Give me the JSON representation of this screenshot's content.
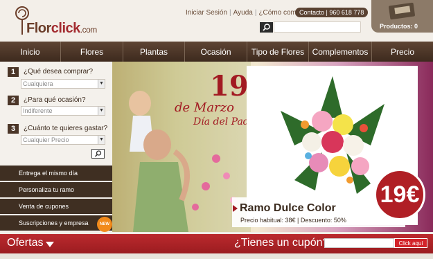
{
  "brand": {
    "logo_part1": "Flor",
    "logo_part2": "click",
    "logo_part3": ".com"
  },
  "header": {
    "links": [
      "Iniciar Sesión",
      "Ayuda",
      "¿Cómo comprar?"
    ],
    "contact": "Contacto | 960 618 778",
    "search_placeholder": "",
    "cart_label": "Productos: 0"
  },
  "nav": {
    "items": [
      "Inicio",
      "Flores",
      "Plantas",
      "Ocasión",
      "Tipo de Flores",
      "Complementos",
      "Precio"
    ]
  },
  "sidebar": {
    "questions": [
      {
        "number": "1",
        "label": "¿Qué desea comprar?",
        "value": "Cualquiera"
      },
      {
        "number": "2",
        "label": "¿Para qué ocasión?",
        "value": "Indiferente"
      },
      {
        "number": "3",
        "label": "¿Cuánto te quieres gastar?",
        "value": "Cualquier Precio"
      }
    ],
    "links": [
      "Entrega el mismo día",
      "Personaliza tu ramo",
      "Venta de cupones",
      "Suscripciones y empresa"
    ],
    "new_badge": "NEW"
  },
  "banner": {
    "date_number": "19",
    "date_line1": "de Marzo",
    "date_line2": "Día del Padre",
    "product_name": "Ramo Dulce Color",
    "product_price_info": "Precio habitual: 38€ | Descuento: 50%",
    "price": "19€"
  },
  "bottom": {
    "offers_label": "Ofertas",
    "coupon_question": "¿Tienes un cupón?",
    "coupon_button": "Click aquí"
  },
  "colors": {
    "brand_brown": "#4b3628",
    "brand_red": "#b01f25",
    "nav_bg": "#5e4433"
  }
}
